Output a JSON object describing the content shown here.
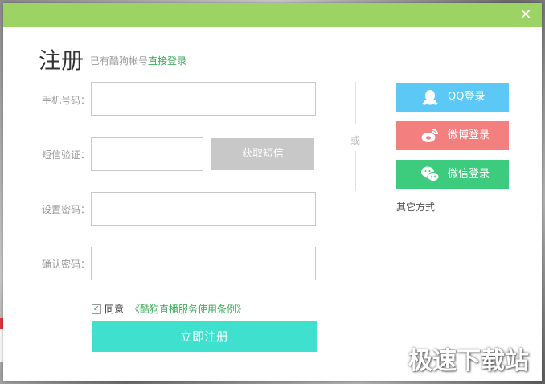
{
  "dialog": {
    "close_glyph": "✕",
    "heading": "注册",
    "subtitle_prefix": "已有酷狗帐号",
    "login_link": "直接登录"
  },
  "form": {
    "phone_label": "手机号码：",
    "phone_value": "",
    "sms_label": "短信验证：",
    "sms_value": "",
    "sms_button": "获取短信",
    "password_label": "设置密码：",
    "password_value": "",
    "confirm_label": "确认密码：",
    "confirm_value": "",
    "agree_checked": "✓",
    "agree_label": "同意",
    "terms_link": "《酷狗直播服务使用条例》",
    "submit_button": "立即注册"
  },
  "social": {
    "or_label": "或",
    "qq_button": "QQ登录",
    "weibo_button": "微博登录",
    "wechat_button": "微信登录",
    "others_label": "其它方式",
    "colors": {
      "qq": "#5bc8f5",
      "weibo": "#f47f7f",
      "wechat": "#3dcc7e"
    }
  },
  "icons": [
    "close-icon",
    "qq-penguin-icon",
    "weibo-icon",
    "wechat-icon",
    "checkmark-icon"
  ],
  "watermark": "极速下载站",
  "colors": {
    "titlebar": "#9cd365",
    "accent_link": "#3aa857",
    "submit": "#40e0cf",
    "sms_button": "#c8c8c8"
  }
}
